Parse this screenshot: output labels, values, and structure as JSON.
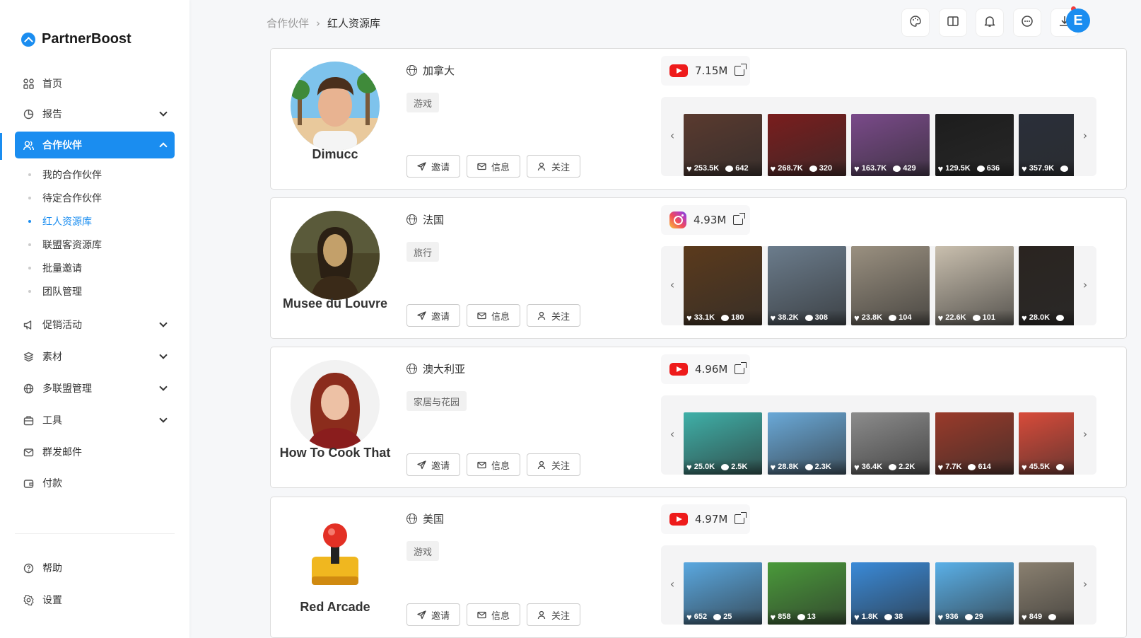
{
  "app": {
    "name": "PartnerBoost"
  },
  "sidebar": {
    "items": [
      {
        "label": "首页",
        "icon": "grid-icon"
      },
      {
        "label": "报告",
        "icon": "pie-chart-icon"
      },
      {
        "label": "合作伙伴",
        "icon": "users-icon"
      },
      {
        "label": "促销活动",
        "icon": "megaphone-icon"
      },
      {
        "label": "素材",
        "icon": "layers-icon"
      },
      {
        "label": "多联盟管理",
        "icon": "globe-icon"
      },
      {
        "label": "工具",
        "icon": "toolbox-icon"
      },
      {
        "label": "群发邮件",
        "icon": "mail-icon"
      },
      {
        "label": "付款",
        "icon": "wallet-icon"
      },
      {
        "label": "帮助",
        "icon": "help-icon"
      },
      {
        "label": "设置",
        "icon": "gear-icon"
      }
    ],
    "partner_sub": [
      "我的合作伙伴",
      "待定合作伙伴",
      "红人资源库",
      "联盟客资源库",
      "批量邀请",
      "团队管理"
    ],
    "active_sub": "红人资源库"
  },
  "breadcrumb": {
    "parent": "合作伙伴",
    "current": "红人资源库"
  },
  "header": {
    "icons": [
      "palette-icon",
      "book-icon",
      "bell-icon",
      "chat-icon",
      "download-icon"
    ],
    "user_initial": "E"
  },
  "actions": {
    "invite": "邀请",
    "message": "信息",
    "follow": "关注"
  },
  "influencers": [
    {
      "name": "Dimucc",
      "country": "加拿大",
      "category": "游戏",
      "platform": "youtube",
      "followers": "7.15M",
      "posts": [
        {
          "likes": "253.5K",
          "comments": "642",
          "color": "#5a3a2f"
        },
        {
          "likes": "268.7K",
          "comments": "320",
          "color": "#7a1d1d"
        },
        {
          "likes": "163.7K",
          "comments": "429",
          "color": "#7a4a8a"
        },
        {
          "likes": "129.5K",
          "comments": "636",
          "color": "#1d1d1d"
        },
        {
          "likes": "357.9K",
          "comments": "",
          "color": "#2a2f3a"
        }
      ]
    },
    {
      "name": "Musee du Louvre",
      "country": "法国",
      "category": "旅行",
      "platform": "instagram",
      "followers": "4.93M",
      "posts": [
        {
          "likes": "33.1K",
          "comments": "180",
          "color": "#5b3a1c"
        },
        {
          "likes": "38.2K",
          "comments": "308",
          "color": "#6b7c8c"
        },
        {
          "likes": "23.8K",
          "comments": "104",
          "color": "#9a9080"
        },
        {
          "likes": "22.6K",
          "comments": "101",
          "color": "#c9bfae"
        },
        {
          "likes": "28.0K",
          "comments": "",
          "color": "#2a2420"
        }
      ]
    },
    {
      "name": "How To Cook That",
      "country": "澳大利亚",
      "category": "家居与花园",
      "platform": "youtube",
      "followers": "4.96M",
      "posts": [
        {
          "likes": "25.0K",
          "comments": "2.5K",
          "color": "#3fb0a8"
        },
        {
          "likes": "28.8K",
          "comments": "2.3K",
          "color": "#6aa9d8"
        },
        {
          "likes": "36.4K",
          "comments": "2.2K",
          "color": "#8c8c8c"
        },
        {
          "likes": "7.7K",
          "comments": "614",
          "color": "#9a3a2a"
        },
        {
          "likes": "45.5K",
          "comments": "",
          "color": "#d84b3a"
        }
      ]
    },
    {
      "name": "Red Arcade",
      "country": "美国",
      "category": "游戏",
      "platform": "youtube",
      "followers": "4.97M",
      "posts": [
        {
          "likes": "652",
          "comments": "25",
          "color": "#5aa8e0"
        },
        {
          "likes": "858",
          "comments": "13",
          "color": "#4a9a3a"
        },
        {
          "likes": "1.8K",
          "comments": "38",
          "color": "#3a8ad8"
        },
        {
          "likes": "936",
          "comments": "29",
          "color": "#5ab0e8"
        },
        {
          "likes": "849",
          "comments": "",
          "color": "#8a8070"
        }
      ]
    }
  ],
  "colors": {
    "accent": "#1a8df0",
    "youtube": "#ee1b1b"
  }
}
